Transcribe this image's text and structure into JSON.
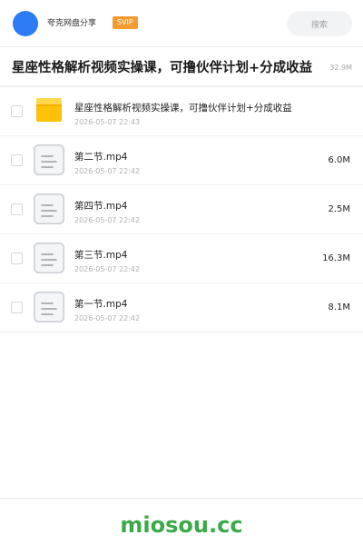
{
  "header": {
    "share_name": "夸克网盘分享",
    "svip_badge": "SVIP",
    "search_placeholder": "搜索",
    "avatar_color": "#2b7cf5"
  },
  "title": {
    "text": "星座性格解析视频实操课，可撸伙伴计划+分成收益",
    "total_size": "32.9M"
  },
  "files": [
    {
      "icon": "folder-icon",
      "name": "星座性格解析视频实操课，可撸伙伴计划+分成收益",
      "date": "2026-05-07 22:43",
      "size": ""
    },
    {
      "icon": "document-icon",
      "name": "第二节.mp4",
      "date": "2026-05-07 22:42",
      "size": "6.0M"
    },
    {
      "icon": "document-icon",
      "name": "第四节.mp4",
      "date": "2026-05-07 22:42",
      "size": "2.5M"
    },
    {
      "icon": "document-icon",
      "name": "第三节.mp4",
      "date": "2026-05-07 22:42",
      "size": "16.3M"
    },
    {
      "icon": "document-icon",
      "name": "第一节.mp4",
      "date": "2026-05-07 22:42",
      "size": "8.1M"
    }
  ],
  "footer": {
    "brand": "miosou.cc",
    "brand_color": "#3aaa48"
  }
}
